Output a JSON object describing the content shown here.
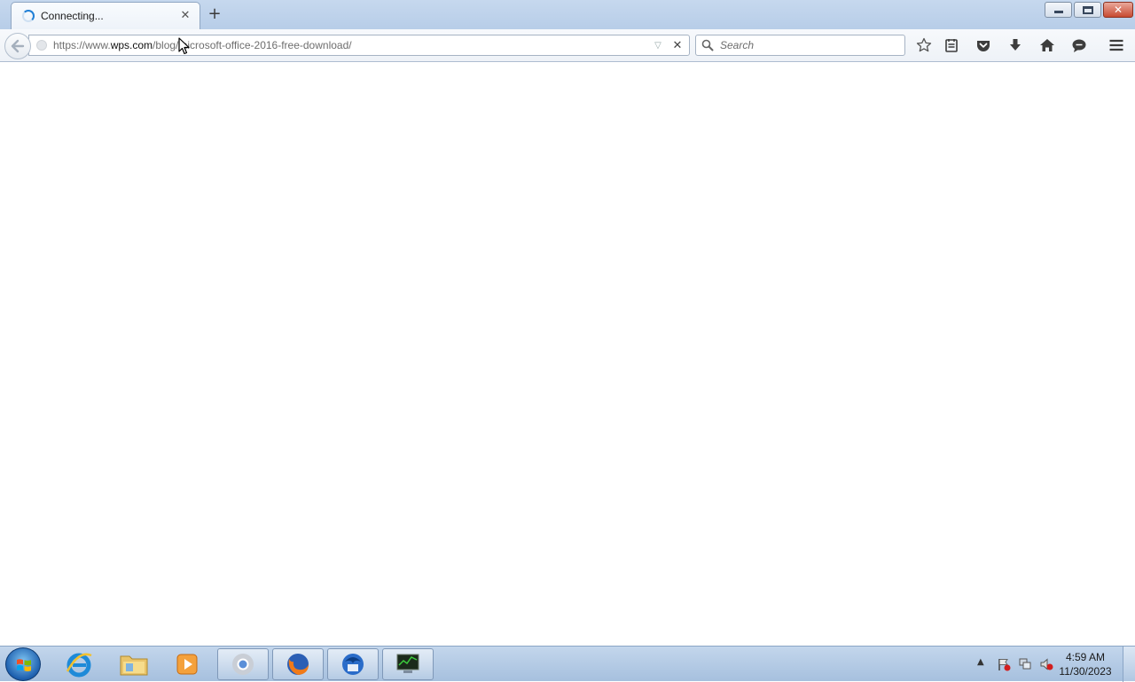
{
  "browser": {
    "tab": {
      "title": "Connecting...",
      "close_glyph": "✕"
    },
    "new_tab_glyph": "+",
    "window_controls": {
      "minimize": "minimize",
      "maximize": "restore",
      "close": "✕"
    }
  },
  "navbar": {
    "url": {
      "prefix": "https://www.",
      "host": "wps.com",
      "path": "/blog/microsoft-office-2016-free-download/"
    },
    "search_placeholder": "Search",
    "stop_glyph": "✕",
    "dropmarker_glyph": "▽",
    "toolbar_icons": [
      "bookmark-star-icon",
      "reading-list-icon",
      "pocket-icon",
      "download-icon",
      "home-icon",
      "chat-icon",
      "menu-icon"
    ]
  },
  "taskbar": {
    "apps": [
      {
        "name": "internet-explorer",
        "active": false
      },
      {
        "name": "file-explorer",
        "active": false
      },
      {
        "name": "media-player",
        "active": false
      },
      {
        "name": "chrome",
        "active": true
      },
      {
        "name": "firefox",
        "active": true
      },
      {
        "name": "thunderbird",
        "active": true
      },
      {
        "name": "system-monitor",
        "active": true
      }
    ],
    "clock": {
      "time": "4:59 AM",
      "date": "11/30/2023"
    }
  },
  "colors": {
    "accent": "#1f7fd6",
    "taskbar": "#a6c0de",
    "titlebar": "#b7cde8",
    "close_button": "#c84a31"
  }
}
